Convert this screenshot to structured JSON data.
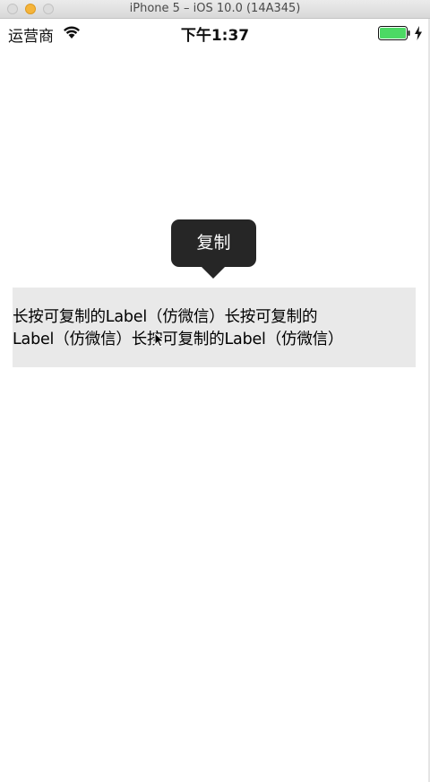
{
  "window": {
    "title": "iPhone 5 – iOS 10.0 (14A345)"
  },
  "status_bar": {
    "carrier": "运营商",
    "time": "下午1:37",
    "battery_color": "#4cd964"
  },
  "menu": {
    "copy_label": "复制"
  },
  "label": {
    "text": "长按可复制的Label（仿微信）长按可复制的\nLabel（仿微信）长按可复制的Label（仿微信）"
  }
}
